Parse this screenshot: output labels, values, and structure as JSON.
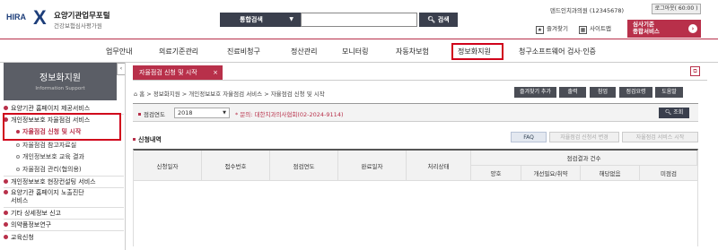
{
  "header": {
    "logo_mark": "HIRA",
    "logo_title": "요양기관업무포털",
    "logo_subtitle": "건강보험심사평가원",
    "search_category": "통합검색",
    "search_placeholder": "",
    "search_button": "검색",
    "user_name": "덴드인치과의원 (12345678)",
    "logout_label": "로그아웃( 60:00 )",
    "favorites_label": "즐겨찾기",
    "sitemap_label": "사이트맵",
    "review_button_line1": "심사기준",
    "review_button_line2": "종합서비스"
  },
  "mainnav": {
    "items": [
      "업무안내",
      "의료기준관리",
      "진료비청구",
      "정산관리",
      "모니터링",
      "자동차보험",
      "정보화지원",
      "청구소프트웨어 검사·인증"
    ],
    "active": "정보화지원"
  },
  "sidebar": {
    "title": "정보화지원",
    "subtitle": "Information Support",
    "items": [
      {
        "label": "요양기관 홈페이지 제공서비스"
      },
      {
        "label": "개인정보보호 자율점검 서비스"
      },
      {
        "label": "자율점검 신청 및 시작"
      },
      {
        "label": "자율점검 참고자료실"
      },
      {
        "label": "개인정보보호 교육 결과"
      },
      {
        "label": "자율점검 관리(협의용)"
      },
      {
        "label": "개인정보보호 현장컨설팅 서비스"
      },
      {
        "label": "요양기관 홈페이지 노출진단"
      },
      {
        "label": "서비스"
      },
      {
        "label": "기타 상세정보 신고"
      },
      {
        "label": "의약품정보연구"
      },
      {
        "label": "교육신청"
      }
    ]
  },
  "content": {
    "tab_label": "자율점검 신청 및 시작",
    "breadcrumb": "홈 > 정보화지원 > 개인정보보호 자율점검 서비스 > 자율점검 신청 및 시작",
    "actions": [
      "즐겨찾기 추가",
      "출력",
      "참업",
      "점검요령",
      "도움말"
    ],
    "filter": {
      "label": "점검연도",
      "year": "2018",
      "note": "* 문의: 대한치과의사협회(02-2024-9114)",
      "search_button": "조회"
    },
    "section_title": "신청내역",
    "faq_button": "FAQ",
    "apply_change_button": "자율점검 신청서 변경",
    "stop_service_button": "자율점검 서비스 시작",
    "table": {
      "headers": [
        "신청일자",
        "접수번호",
        "점검연도",
        "완료일자",
        "처리상태"
      ],
      "group_header": "점검결과 건수",
      "sub_headers": [
        "양호",
        "개선필요/취약",
        "해당없음",
        "미점검"
      ]
    }
  },
  "colors": {
    "accent": "#b8304a",
    "dark_button": "#3a3f4d",
    "highlight_box": "#d0021b"
  }
}
